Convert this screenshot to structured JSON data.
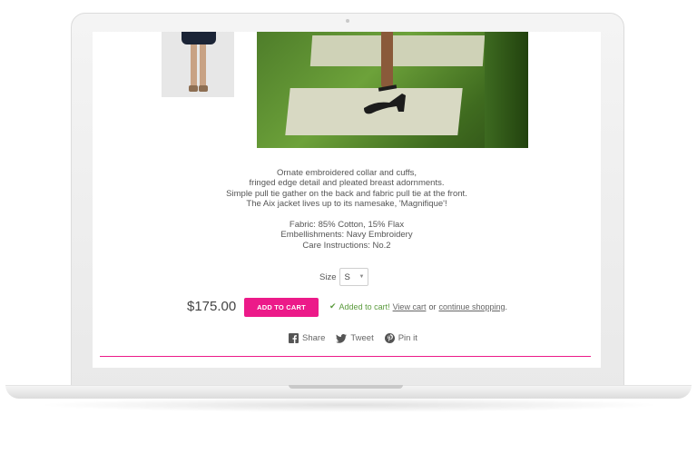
{
  "product": {
    "description_lines": [
      "Ornate embroidered collar and cuffs,",
      "fringed edge detail and pleated breast adornments.",
      "Simple pull tie gather on the back and fabric pull tie at the front.",
      "The Aix jacket lives up to its namesake, 'Magnifique'!"
    ],
    "details_lines": [
      "Fabric: 85% Cotton, 15% Flax",
      "Embellishments: Navy Embroidery",
      "Care Instructions: No.2"
    ],
    "size_label": "Size",
    "size_value": "S",
    "price": "$175.00",
    "add_to_cart_label": "ADD TO CART"
  },
  "cart_message": {
    "added_text": "Added to cart!",
    "view_cart_label": "View cart",
    "or_text": "or",
    "continue_label": "continue shopping",
    "end_punct": "."
  },
  "share": {
    "facebook_label": "Share",
    "twitter_label": "Tweet",
    "pinterest_label": "Pin it"
  },
  "colors": {
    "accent": "#ec1a89",
    "success": "#5a9a3c"
  }
}
